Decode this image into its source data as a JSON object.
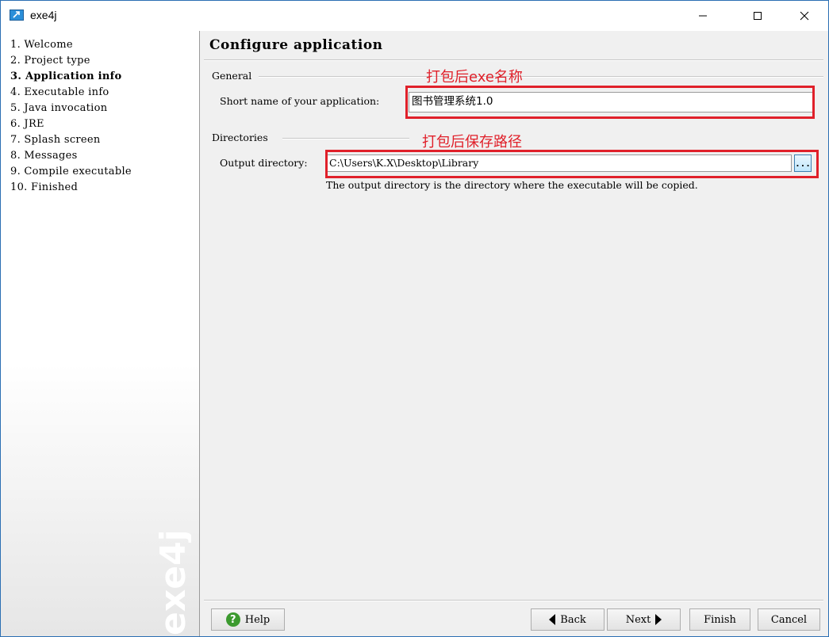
{
  "window": {
    "title": "exe4j",
    "minimize_glyph": "—",
    "maximize_glyph": "☐",
    "close_glyph": "✕"
  },
  "sidebar": {
    "steps": [
      {
        "label": "1. Welcome"
      },
      {
        "label": "2. Project type"
      },
      {
        "label": "3. Application info",
        "active": true
      },
      {
        "label": "4. Executable info"
      },
      {
        "label": "5. Java invocation"
      },
      {
        "label": "6. JRE"
      },
      {
        "label": "7. Splash screen"
      },
      {
        "label": "8. Messages"
      },
      {
        "label": "9. Compile executable"
      },
      {
        "label": "10. Finished"
      }
    ],
    "watermark": "exe4j"
  },
  "main": {
    "title": "Configure application",
    "general": {
      "section_label": "General",
      "short_name_label": "Short name of your application:",
      "short_name_value": "图书管理系统1.0"
    },
    "directories": {
      "section_label": "Directories",
      "output_dir_label": "Output directory:",
      "output_dir_value": "C:\\Users\\K.X\\Desktop\\Library",
      "browse_label": "...",
      "hint": "The output directory is the directory where the executable will be copied."
    }
  },
  "annotations": {
    "exe_name_note": "打包后exe名称",
    "save_path_note": "打包后保存路径",
    "color": "#e0202a"
  },
  "buttons": {
    "help": "Help",
    "back": "Back",
    "next": "Next",
    "finish": "Finish",
    "cancel": "Cancel"
  },
  "icons": {
    "app": "exe4j-app-icon",
    "help": "help-question-icon",
    "back": "triangle-left-icon",
    "next": "triangle-right-icon"
  }
}
